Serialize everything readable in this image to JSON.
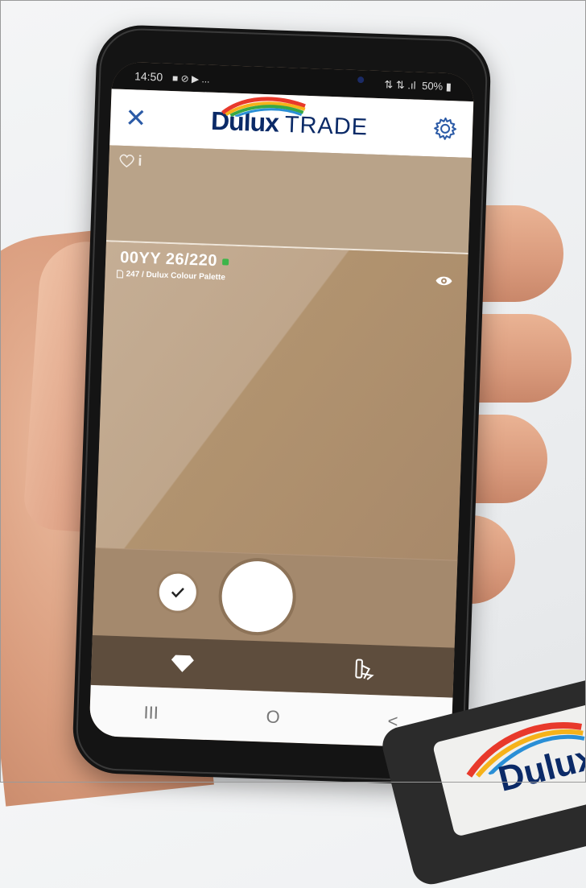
{
  "status_bar": {
    "time": "14:50",
    "left_icons": "■ ⊘ ▶ ...",
    "right_icons": "⇅ ⇅ .ıl",
    "battery": "50%"
  },
  "header": {
    "brand": "Dulux",
    "sub_brand": "TRADE"
  },
  "colour": {
    "code": "00YY 26/220",
    "palette": "247 / Dulux Colour Palette",
    "info_label": "i"
  },
  "nav_bar": {
    "recents": "III",
    "home": "O",
    "back": "<"
  },
  "device": {
    "brand": "Dulux"
  },
  "colors": {
    "swatch": "#b1936f",
    "tab_bar": "#5e4d3d",
    "brand_blue": "#0b2a67"
  }
}
